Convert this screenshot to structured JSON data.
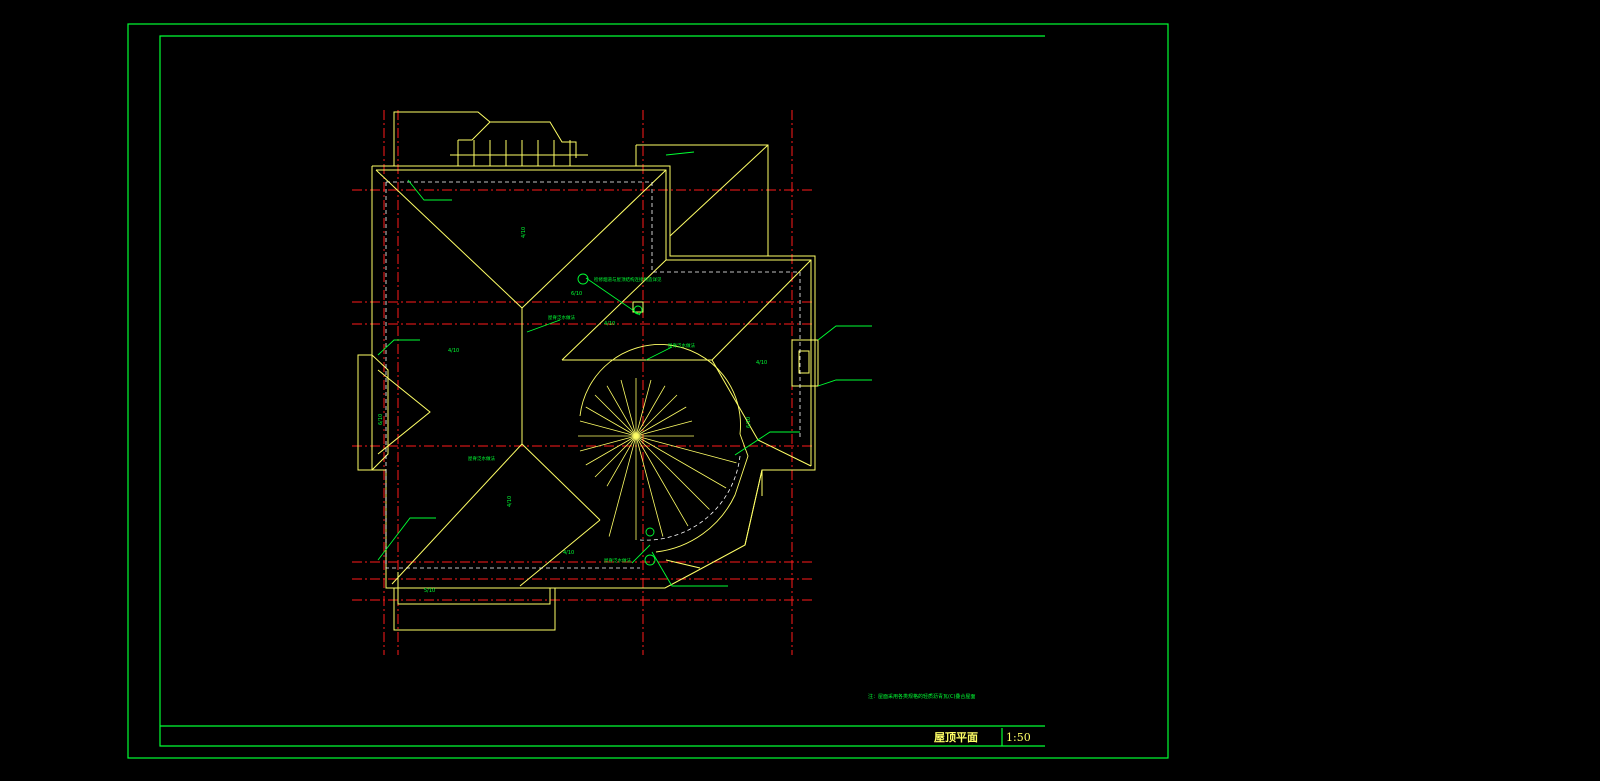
{
  "drawing": {
    "title": "屋顶平面",
    "scale": "1:50",
    "note": "注：屋面采用各类规格的轻质沥青瓦(C)叠合屋面",
    "slope_labels": [
      "4/10",
      "4/10",
      "6/10",
      "4/10",
      "6/10",
      "4/10",
      "4/10",
      "6/10",
      "5/10",
      "4/10"
    ],
    "callouts": [
      "检修烟道与屋顶结构连接构造详见",
      "屋脊泛水做法",
      "屋脊泛水做法",
      "屋脊泛水做法",
      "屋脊泛水做法"
    ],
    "colors": {
      "frame": "#00ff33",
      "roof_lines": "#ffff66",
      "axis_lines": "#ff1a1a",
      "dashed_eave": "#ffffff",
      "annotation": "#00ff33"
    }
  }
}
